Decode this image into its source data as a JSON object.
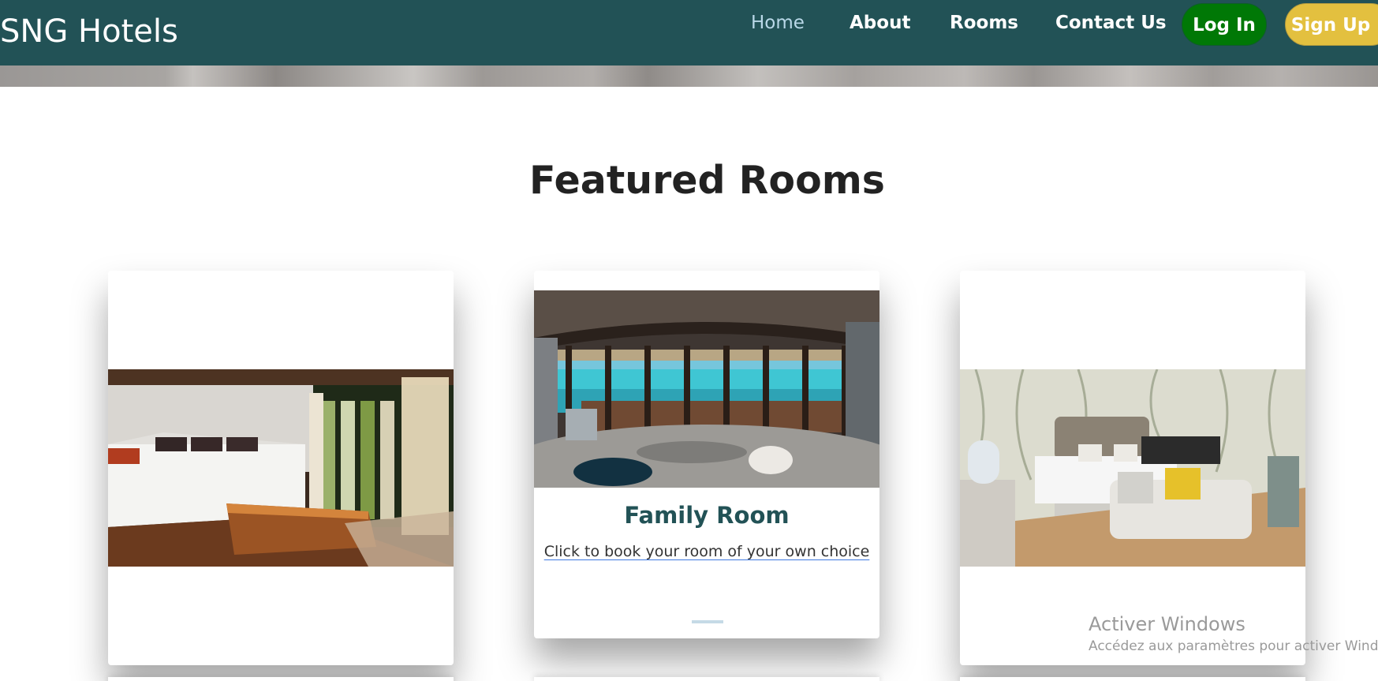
{
  "header": {
    "brand": "SNG Hotels",
    "nav": [
      "Home",
      "About",
      "Rooms",
      "Contact Us"
    ],
    "login_label": "Log In",
    "signup_label": "Sign Up"
  },
  "main": {
    "section_title": "Featured Rooms",
    "cards": [
      {
        "image": "bedroom-sunlit-photo"
      },
      {
        "image": "ocean-villa-photo",
        "title": "Family Room",
        "link": "Click to book your room of your own choice"
      },
      {
        "image": "wallpaper-suite-photo"
      }
    ]
  },
  "watermark": {
    "title": "Activer Windows",
    "subtitle": "Accédez aux paramètres pour activer Windows."
  },
  "colors": {
    "navbar": "#225256",
    "login": "#007806",
    "signup": "#e3c03f",
    "accent": "#225256"
  }
}
